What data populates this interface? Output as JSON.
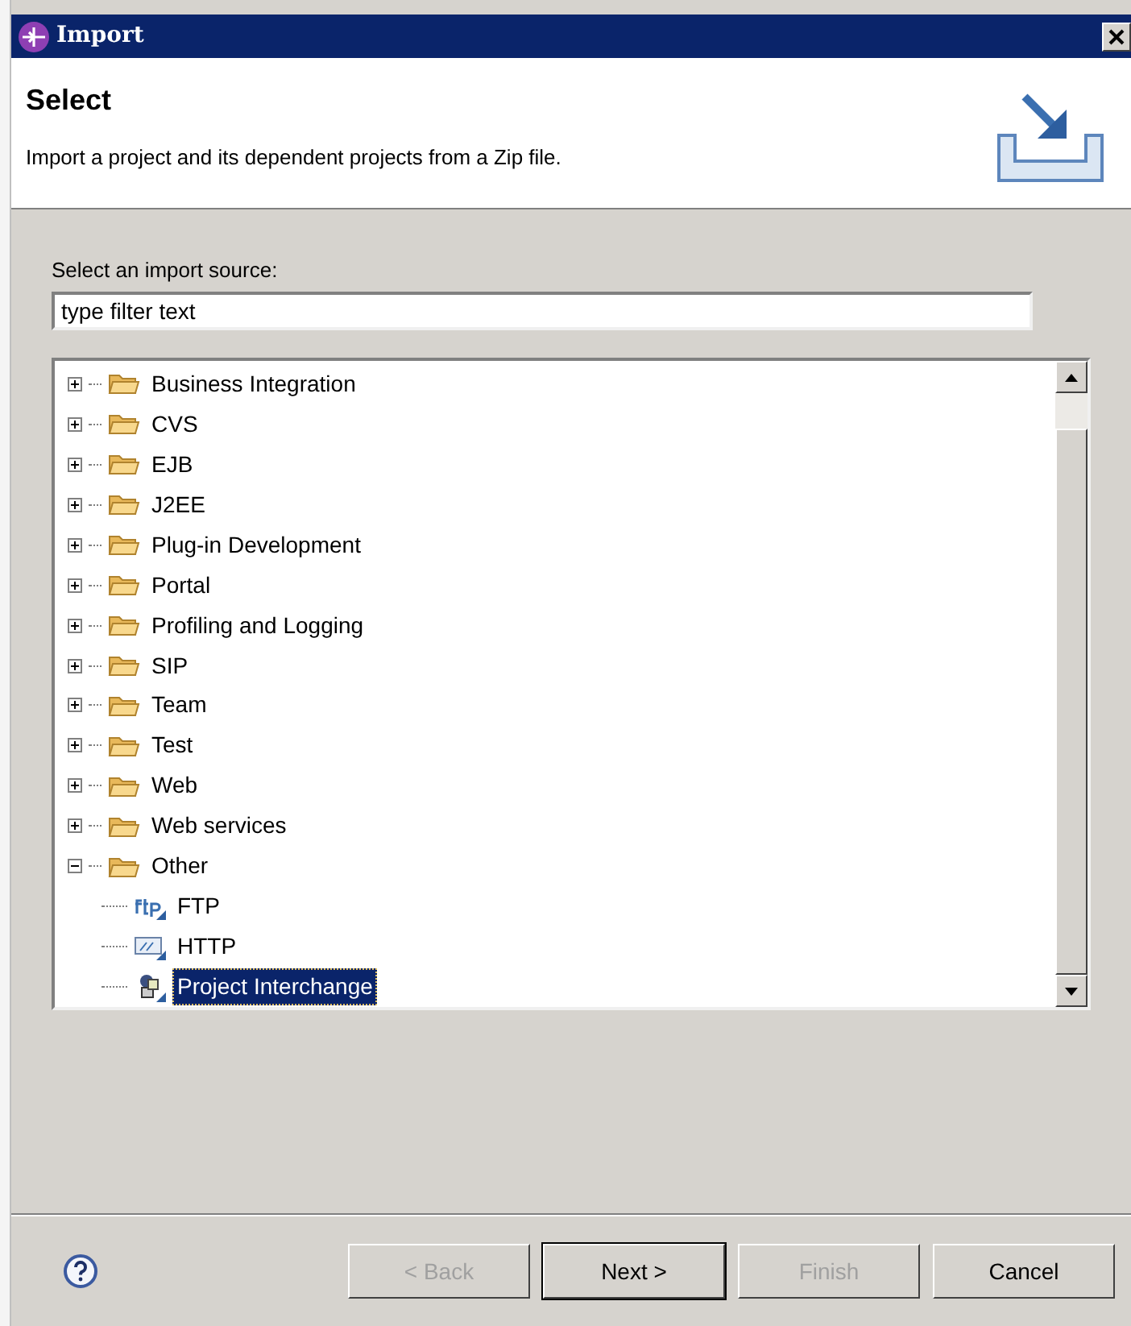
{
  "window": {
    "title": "Import"
  },
  "header": {
    "title": "Select",
    "description": "Import a project and its dependent projects from a Zip file."
  },
  "source": {
    "label": "Select an import source:",
    "filter": {
      "value": "type filter text"
    }
  },
  "tree": {
    "items": [
      {
        "label": "Business Integration",
        "kind": "folder",
        "expanded": false,
        "selected": false
      },
      {
        "label": "CVS",
        "kind": "folder",
        "expanded": false,
        "selected": false
      },
      {
        "label": "EJB",
        "kind": "folder",
        "expanded": false,
        "selected": false
      },
      {
        "label": "J2EE",
        "kind": "folder",
        "expanded": false,
        "selected": false
      },
      {
        "label": "Plug-in Development",
        "kind": "folder",
        "expanded": false,
        "selected": false
      },
      {
        "label": "Portal",
        "kind": "folder",
        "expanded": false,
        "selected": false
      },
      {
        "label": "Profiling and Logging",
        "kind": "folder",
        "expanded": false,
        "selected": false
      },
      {
        "label": "SIP",
        "kind": "folder",
        "expanded": false,
        "selected": false
      },
      {
        "label": "Team",
        "kind": "folder",
        "expanded": false,
        "selected": false
      },
      {
        "label": "Test",
        "kind": "folder",
        "expanded": false,
        "selected": false
      },
      {
        "label": "Web",
        "kind": "folder",
        "expanded": false,
        "selected": false
      },
      {
        "label": "Web services",
        "kind": "folder",
        "expanded": false,
        "selected": false
      },
      {
        "label": "Other",
        "kind": "folder",
        "expanded": true,
        "selected": false,
        "children": [
          {
            "label": "FTP",
            "kind": "ftp",
            "selected": false
          },
          {
            "label": "HTTP",
            "kind": "http",
            "selected": false
          },
          {
            "label": "Project Interchange",
            "kind": "project",
            "selected": true
          }
        ]
      }
    ]
  },
  "buttons": [
    {
      "label": "< Back",
      "disabled": true,
      "default": false
    },
    {
      "label": "Next >",
      "disabled": false,
      "default": true
    },
    {
      "label": "Finish",
      "disabled": true,
      "default": false
    },
    {
      "label": "Cancel",
      "disabled": false,
      "default": false
    }
  ]
}
